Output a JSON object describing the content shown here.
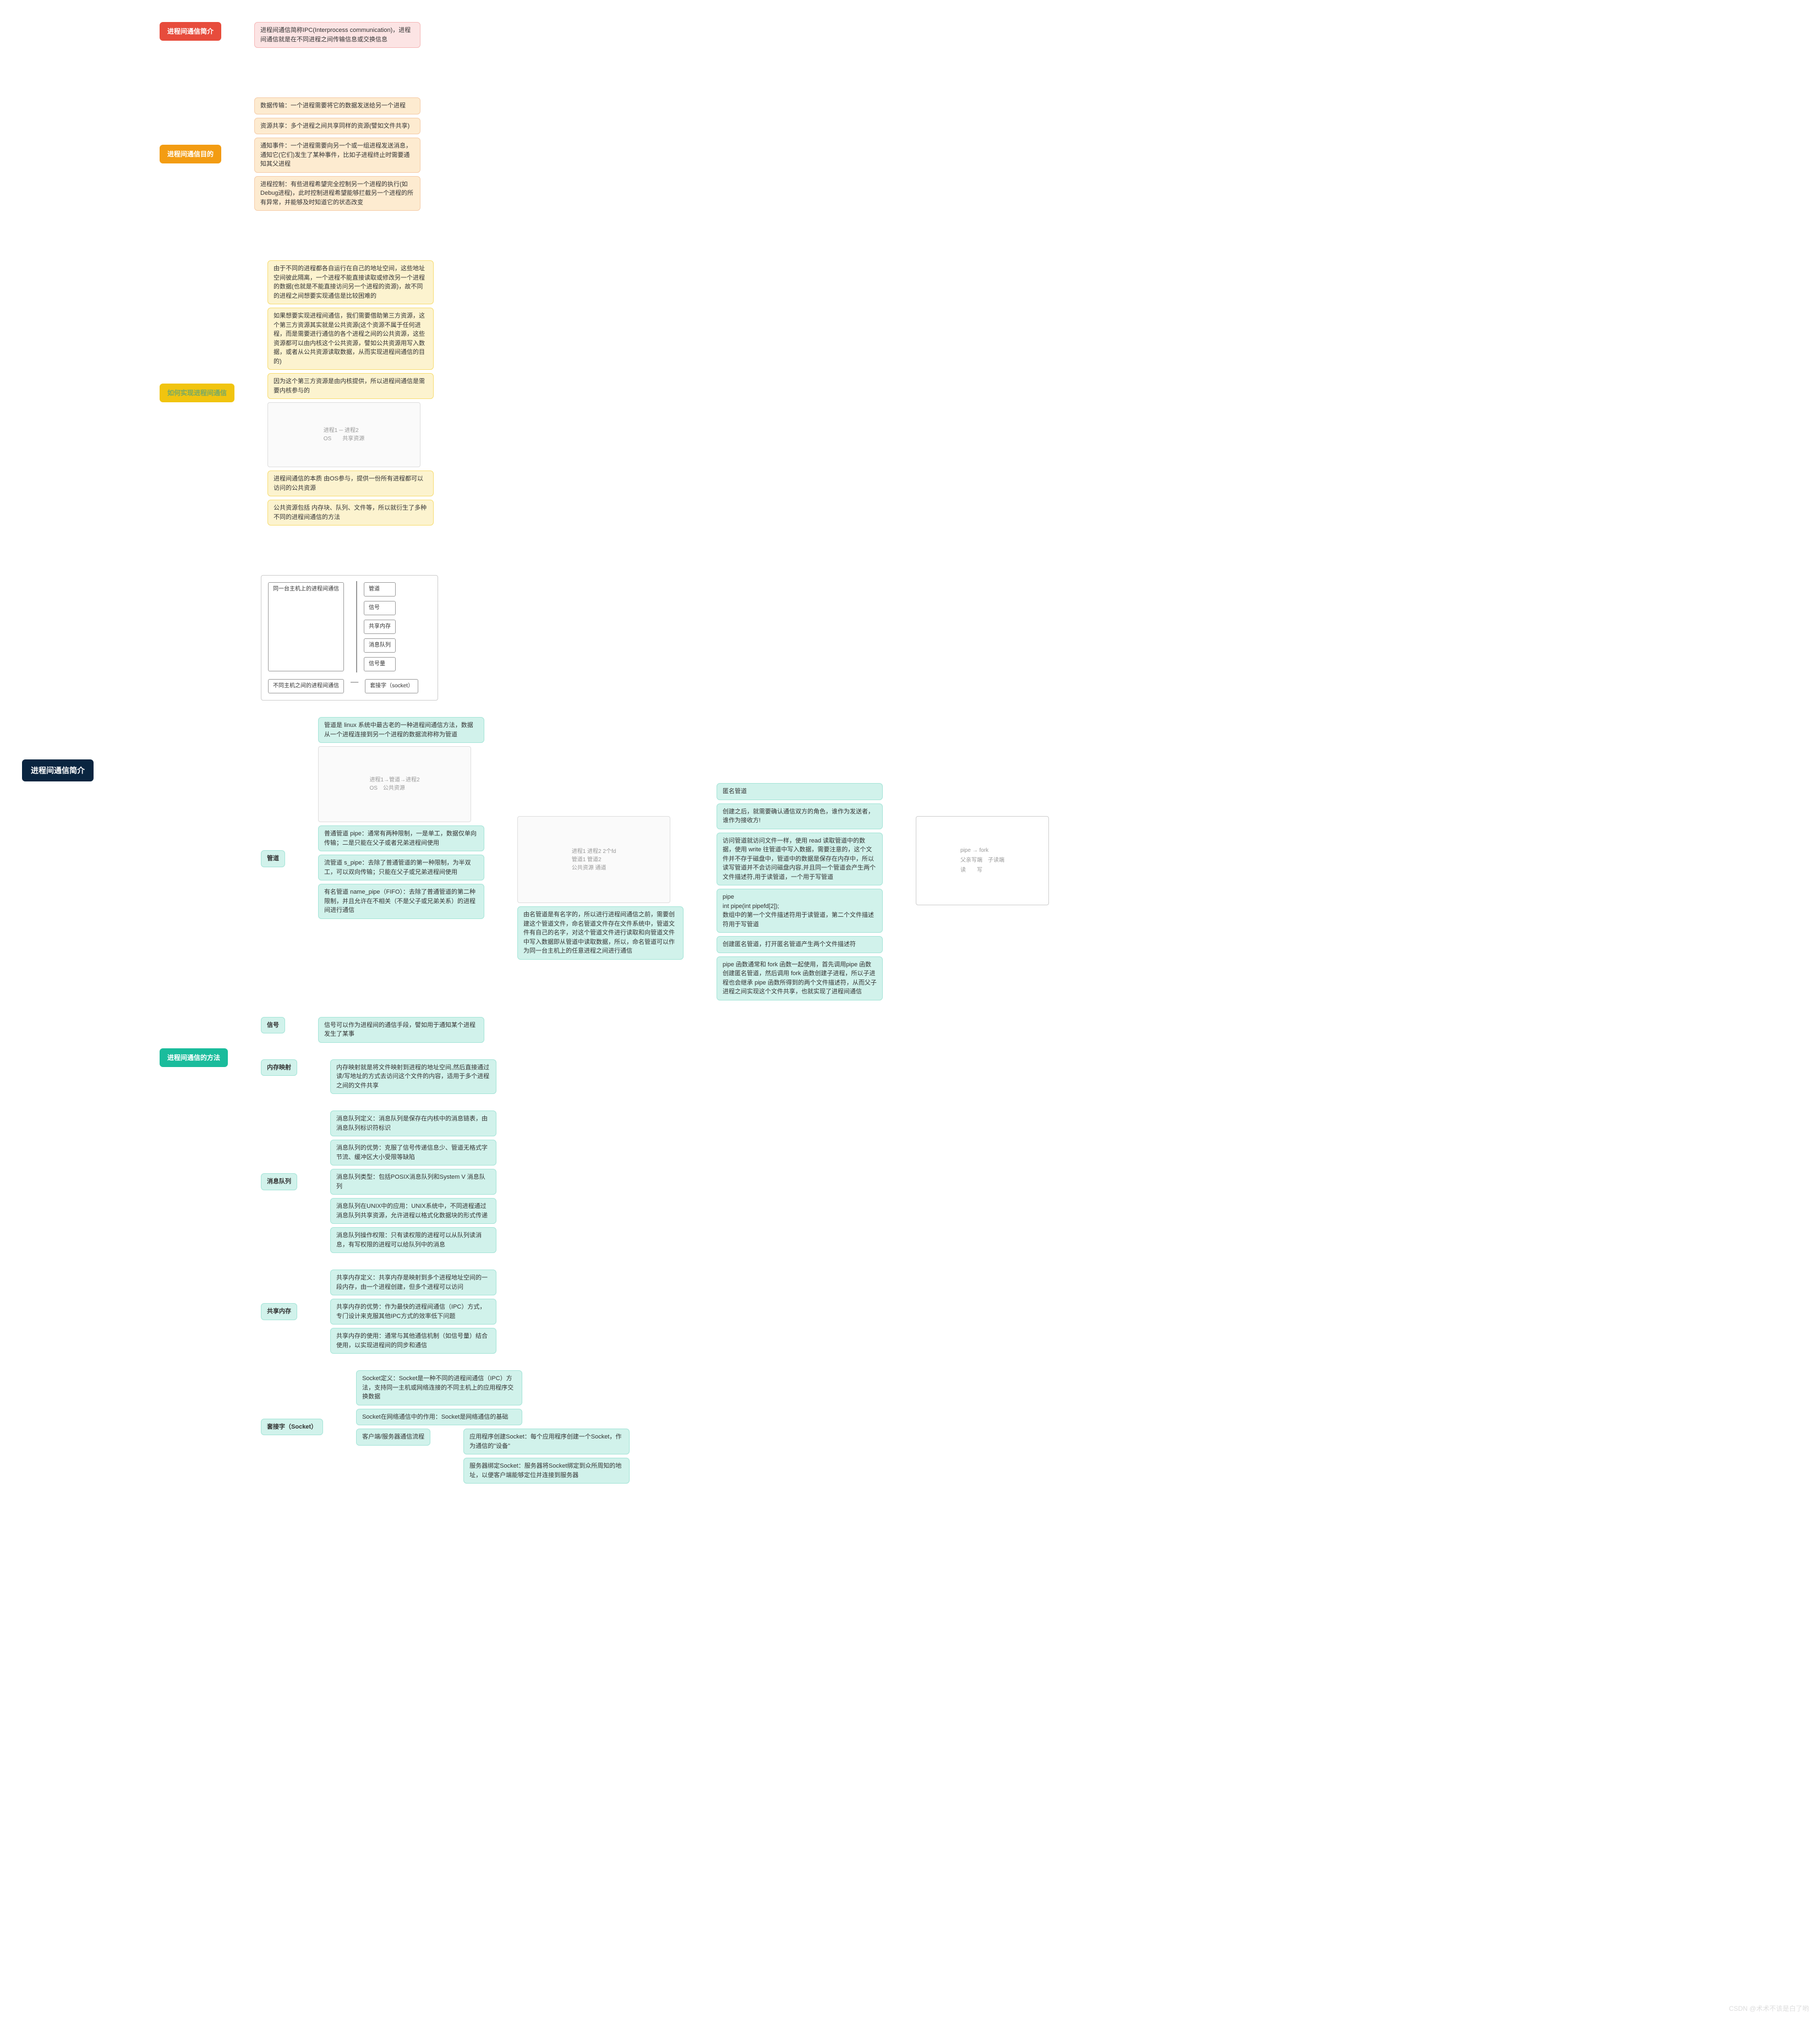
{
  "root": "进程间通信简介",
  "b1": {
    "title": "进程间通信简介",
    "leaf": "进程间通信简称IPC(Interprocess communication)，进程间通信就是在不同进程之间传输信息或交换信息"
  },
  "b2": {
    "title": "进程间通信目的",
    "l1": "数据传输：一个进程需要将它的数据发送给另一个进程",
    "l2": "资源共享：多个进程之间共享同样的资源(譬如文件共享)",
    "l3": "通知事件：一个进程需要向另一个或一组进程发送消息，通知它(它们)发生了某种事件，比如子进程终止时需要通知其父进程",
    "l4": "进程控制：有些进程希望完全控制另一个进程的执行(如 Debug进程)，此时控制进程希望能够拦截另一个进程的所有异常，并能够及时知道它的状态改变"
  },
  "b3": {
    "title": "如何实现进程间通信",
    "l1": "由于不同的进程都各自运行在自己的地址空间，这些地址空间彼此隔离，一个进程不能直接读取或修改另一个进程的数据(也就是不能直接访问另一个进程的资源)，故不同的进程之间想要实现通信是比较困难的",
    "l2": "如果想要实现进程间通信，我们需要借助第三方资源，这个第三方资源其实就是公共资源(这个资源不属于任何进程，而是需要进行通信的各个进程之间的公共资源，这些资源都可以由内核这个公共资源，譬如公共资源用写入数据，或者从公共资源读取数据，从而实现进程间通信的目的)",
    "l3": "因为这个第三方资源是由内核提供，所以进程间通信是需要内核参与的",
    "l4": "进程间通信的本质 由OS参与，提供一份所有进程都可以访问的公共资源",
    "l5": "公共资源包括 内存块、队列、文件等，所以就衍生了多种不同的进程间通信的方法"
  },
  "b4": {
    "title": "进程间通信的方法",
    "same": "同一台主机上的进程间通信",
    "methods": [
      "管道",
      "信号",
      "共享内存",
      "消息队列",
      "信号量"
    ],
    "diff": "不同主机之间的进程间通信",
    "socket": "套接字（socket）",
    "pipe": {
      "title": "管道",
      "l1": "管道是 linux 系统中最古老的一种进程间通信方法，数据从一个进程连接到另一个进程的数据流称称为管道",
      "l2": "普通管道 pipe：通常有两种限制，一是单工，数据仅单向传输；二是只能在父子或者兄弟进程间使用",
      "l3": "流管道 s_pipe：去除了普通管道的第一种限制，为半双工，可以双向传输；只能在父子或兄弟进程间使用",
      "l4": "有名管道 name_pipe（FIFO）：去除了普通管道的第二种限制，并且允许在不相关（不是父子或兄弟关系）的进程间进行通信",
      "anon": "由名管道是有名字的，所以进行进程间通信之前，需要创建这个管道文件，命名管道文件存在文件系统中，管道文件有自己的名字，对这个管道文件进行读取和向管道文件中写入数据即从管道中读取数据，所以，命名管道可以作为同一台主机上的任意进程之间进行通信",
      "r": {
        "l1": "匿名管道",
        "l2": "创建之后，就需要确认通信双方的角色，谁作为发送者，谁作为接收方!",
        "l3": "访问管道就访问文件一样，使用 read 读取管道中的数据，使用 write 往管道中写入数据，需要注意的，这个文件并不存于磁盘中，管道中的数据是保存在内存中，所以读写管道并不会访问磁盘内容,并且同一个管道会产生两个文件描述符,用于读管道，一个用于写管道",
        "l4": "pipe\nint pipe(int pipefd[2]);\n数组中的第一个文件描述符用于读管道，第二个文件描述符用于写管道",
        "l5": "创建匿名管道，打开匿名管道产生两个文件描述符",
        "l6": "pipe 函数通常和 fork 函数一起使用，首先调用pipe 函数创建匿名管道，然后调用 fork 函数创建子进程，所以子进程也会继承 pipe 函数所得到的两个文件描述符，从而父子进程之间实现这个文件共享，也就实现了进程间通信"
      }
    },
    "sig": {
      "title": "信号",
      "l": "信号可以作为进程间的通信手段，譬如用于通知某个进程发生了某事"
    },
    "mmap": {
      "title": "内存映射",
      "l": "内存映射就是将文件映射到进程的地址空间,然后直接通过读/写地址的方式去访问这个文件的内容，适用于多个进程之间的文件共享"
    },
    "mq": {
      "title": "消息队列",
      "l1": "消息队列定义：消息队列是保存在内核中的消息链表，由消息队列标识符标识",
      "l2": "消息队列的优势：克服了信号传递信息少、管道无格式字节流、缓冲区大小受限等缺陷",
      "l3": "消息队列类型：包括POSIX消息队列和System V 消息队列",
      "l4": "消息队列在UNIX中的应用：UNIX系统中，不同进程通过消息队列共享资源，允许进程以格式化数据块的形式传递",
      "l5": "消息队列操作权限：只有读权限的进程可以从队列读消息，有写权限的进程可以给队列中的消息"
    },
    "shm": {
      "title": "共享内存",
      "l1": "共享内存定义：共享内存是映射到多个进程地址空间的一段内存，由一个进程创建，但多个进程可以访问",
      "l2": "共享内存的优势：作为最快的进程间通信（IPC）方式，专门设计来克服其他IPC方式的效率低下问题",
      "l3": "共享内存的使用：通常与其他通信机制（如信号量）结合使用，以实现进程间的同步和通信"
    },
    "sock": {
      "title": "套接字（Socket）",
      "l1": "Socket定义：Socket是一种不同的进程间通信（IPC）方法，支持同一主机或网络连接的不同主机上的应用程序交换数据",
      "l2": "Socket在网络通信中的作用：Socket是网络通信的基础",
      "l3": "客户端/服务器通信流程",
      "cs1": "应用程序创建Socket：每个应用程序创建一个Socket，作为通信的\"设备\"",
      "cs2": "服务器绑定Socket：服务器将Socket绑定到众所周知的地址，以便客户端能够定位并连接到服务器"
    }
  },
  "watermark": "CSDN @术术不该是白了哟"
}
